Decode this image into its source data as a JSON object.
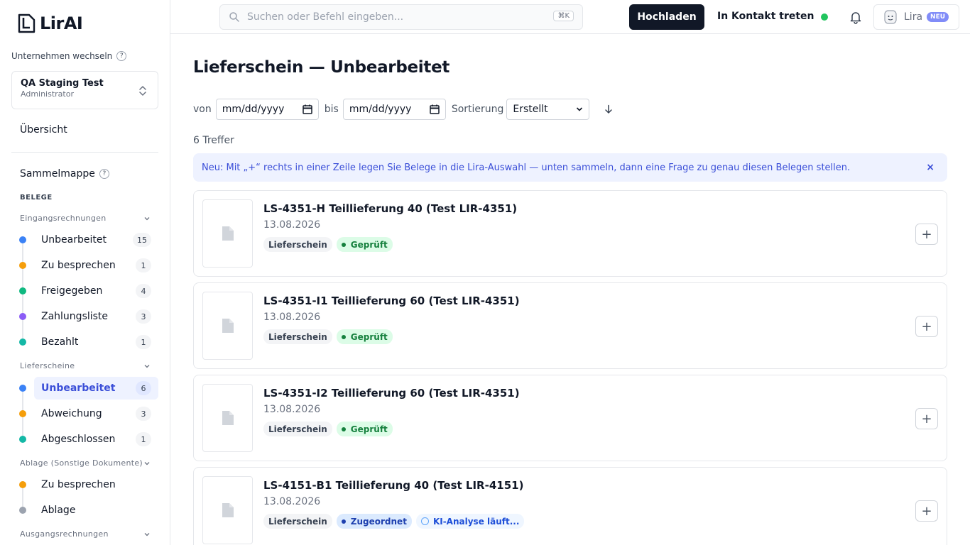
{
  "app": {
    "logo_text": "LirAI"
  },
  "sidebar": {
    "switch_label": "Unternehmen wechseln",
    "company": {
      "name": "QA Staging Test",
      "role": "Administrator"
    },
    "overview": "Übersicht",
    "sammelmappe": "Sammelmappe",
    "section_belege": "BELEGE",
    "groups": [
      {
        "label": "Eingangsrechnungen",
        "items": [
          {
            "label": "Unbearbeitet",
            "count": "15",
            "color": "#3b82f6"
          },
          {
            "label": "Zu besprechen",
            "count": "1",
            "color": "#f59e0b"
          },
          {
            "label": "Freigegeben",
            "count": "4",
            "color": "#10b981"
          },
          {
            "label": "Zahlungsliste",
            "count": "3",
            "color": "#8b5cf6"
          },
          {
            "label": "Bezahlt",
            "count": "1",
            "color": "#14b8a6"
          }
        ]
      },
      {
        "label": "Lieferscheine",
        "items": [
          {
            "label": "Unbearbeitet",
            "count": "6",
            "color": "#3b82f6",
            "active": true
          },
          {
            "label": "Abweichung",
            "count": "3",
            "color": "#f59e0b"
          },
          {
            "label": "Abgeschlossen",
            "count": "1",
            "color": "#14b8a6"
          }
        ]
      },
      {
        "label": "Ablage (Sonstige Dokumente)",
        "items": [
          {
            "label": "Zu besprechen",
            "color": "#f59e0b"
          },
          {
            "label": "Ablage",
            "color": "#9ca3af"
          }
        ]
      },
      {
        "label": "Ausgangsrechnungen",
        "items": []
      }
    ]
  },
  "topbar": {
    "search_placeholder": "Suchen oder Befehl eingeben...",
    "shortcut": "⌘K",
    "upload": "Hochladen",
    "contact": "In Kontakt treten",
    "lira": "Lira",
    "lira_badge": "NEU"
  },
  "main": {
    "title": "Lieferschein — Unbearbeitet",
    "filters": {
      "from_label": "von",
      "from_value": "mm/dd/yyyy",
      "to_label": "bis",
      "to_value": "mm/dd/yyyy",
      "sort_label": "Sortierung",
      "sort_value": "Erstellt"
    },
    "hits": "6 Treffer",
    "info": "Neu: Mit „+“ rechts in einer Zeile legen Sie Belege in die Lira-Auswahl — unten sammeln, dann eine Frage zu genau diesen Belegen stellen.",
    "info_close": "×",
    "cards": [
      {
        "title": "LS-4351-H Teillieferung 40 (Test LIR-4351)",
        "date": "13.08.2026",
        "type": "Lieferschein",
        "status": "Geprüft"
      },
      {
        "title": "LS-4351-I1 Teillieferung 60 (Test LIR-4351)",
        "date": "13.08.2026",
        "type": "Lieferschein",
        "status": "Geprüft"
      },
      {
        "title": "LS-4351-I2 Teillieferung 60 (Test LIR-4351)",
        "date": "13.08.2026",
        "type": "Lieferschein",
        "status": "Geprüft"
      },
      {
        "title": "LS-4151-B1 Teillieferung 40 (Test LIR-4151)",
        "date": "13.08.2026",
        "type": "Lieferschein",
        "status": "Zugeordnet",
        "extra": "KI-Analyse läuft..."
      }
    ]
  }
}
